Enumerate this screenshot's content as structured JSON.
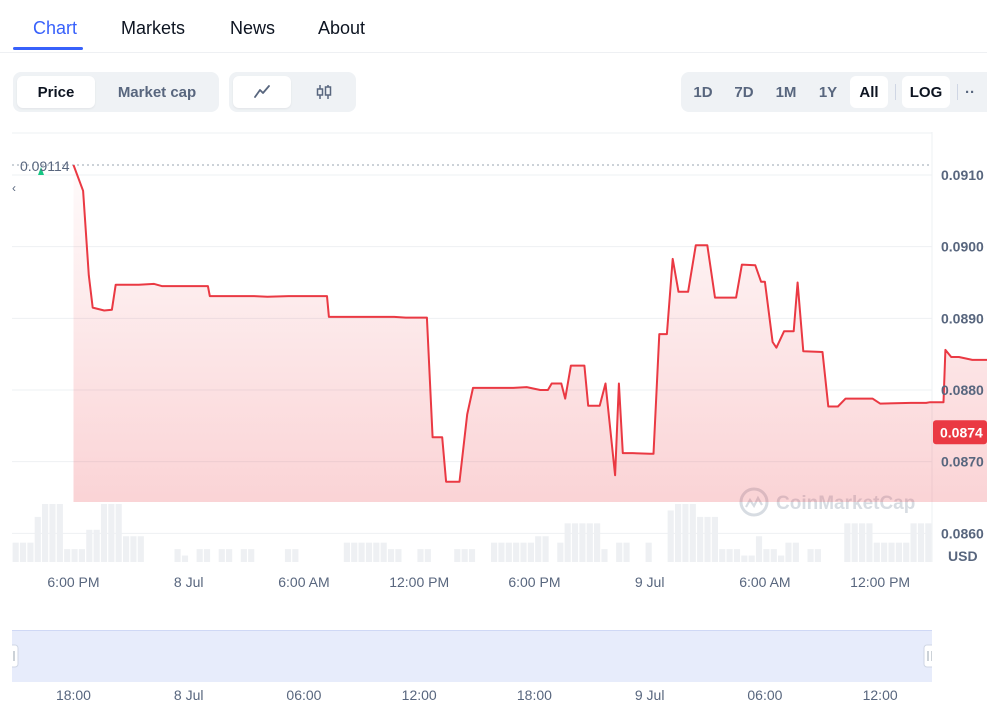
{
  "tabs": [
    {
      "label": "Chart",
      "active": true
    },
    {
      "label": "Markets",
      "active": false
    },
    {
      "label": "News",
      "active": false
    },
    {
      "label": "About",
      "active": false
    }
  ],
  "toolbar": {
    "metric_toggle": [
      {
        "label": "Price",
        "active": true
      },
      {
        "label": "Market cap",
        "active": false
      }
    ],
    "chart_type_toggle": [
      {
        "icon": "line-chart-icon",
        "active": true
      },
      {
        "icon": "candlestick-icon",
        "active": false
      }
    ],
    "ranges": [
      {
        "label": "1D",
        "active": false
      },
      {
        "label": "7D",
        "active": false
      },
      {
        "label": "1M",
        "active": false
      },
      {
        "label": "1Y",
        "active": false
      },
      {
        "label": "All",
        "active": true
      }
    ],
    "log_label": "LOG",
    "more_label": "··"
  },
  "colors": {
    "accent": "#3861fb",
    "line": "#ea3943",
    "up_marker": "#16c784",
    "text_muted": "#58667e"
  },
  "watermark": "CoinMarketCap",
  "open_price_label": "0.09114",
  "current_price_label": "0.0874",
  "currency_label": "USD",
  "chart_data": {
    "type": "line",
    "x_tick_labels": [
      "6:00 PM",
      "8 Jul",
      "6:00 AM",
      "12:00 PM",
      "6:00 PM",
      "9 Jul",
      "6:00 AM",
      "12:00 PM"
    ],
    "y_tick_labels": [
      "0.0910",
      "0.0900",
      "0.0890",
      "0.0880",
      "0.0870",
      "0.0860"
    ],
    "ylim": [
      0.0856,
      0.0916
    ],
    "xlim": [
      -3.2,
      44.7
    ],
    "x_unit": "hours after 6:00 PM, 7 Jul",
    "grid": true,
    "series": [
      {
        "name": "",
        "values": [
          [
            0,
            0.09114
          ],
          [
            0.5,
            0.09078
          ],
          [
            0.8,
            0.0896
          ],
          [
            1.0,
            0.08915
          ],
          [
            1.6,
            0.08911
          ],
          [
            2.0,
            0.08912
          ],
          [
            2.2,
            0.08947
          ],
          [
            3.4,
            0.08947
          ],
          [
            4.2,
            0.08948
          ],
          [
            4.6,
            0.08945
          ],
          [
            7.0,
            0.08945
          ],
          [
            7.1,
            0.08931
          ],
          [
            9.4,
            0.08931
          ],
          [
            10.1,
            0.0893
          ],
          [
            11.2,
            0.08931
          ],
          [
            12.7,
            0.08931
          ],
          [
            13.2,
            0.08931
          ],
          [
            13.3,
            0.08902
          ],
          [
            16.7,
            0.08902
          ],
          [
            17.3,
            0.08901
          ],
          [
            18.4,
            0.08901
          ],
          [
            18.7,
            0.08734
          ],
          [
            19.2,
            0.08734
          ],
          [
            19.4,
            0.08672
          ],
          [
            20.1,
            0.08672
          ],
          [
            20.5,
            0.08766
          ],
          [
            20.8,
            0.08803
          ],
          [
            22.9,
            0.08803
          ],
          [
            23.6,
            0.08804
          ],
          [
            24.3,
            0.088
          ],
          [
            24.7,
            0.088
          ],
          [
            24.9,
            0.08809
          ],
          [
            25.4,
            0.08809
          ],
          [
            25.6,
            0.08788
          ],
          [
            25.9,
            0.08834
          ],
          [
            26.6,
            0.08834
          ],
          [
            26.8,
            0.08778
          ],
          [
            27.4,
            0.08778
          ],
          [
            27.7,
            0.08809
          ],
          [
            28.2,
            0.08681
          ],
          [
            28.4,
            0.08809
          ],
          [
            28.6,
            0.08712
          ],
          [
            29.1,
            0.08712
          ],
          [
            30.0,
            0.08711
          ],
          [
            30.2,
            0.08711
          ],
          [
            30.5,
            0.08878
          ],
          [
            30.9,
            0.08878
          ],
          [
            31.2,
            0.08983
          ],
          [
            31.5,
            0.08937
          ],
          [
            32.0,
            0.08937
          ],
          [
            32.4,
            0.09002
          ],
          [
            33.0,
            0.09002
          ],
          [
            33.4,
            0.08929
          ],
          [
            34.5,
            0.08929
          ],
          [
            34.8,
            0.08975
          ],
          [
            35.5,
            0.08974
          ],
          [
            35.8,
            0.08951
          ],
          [
            36.0,
            0.08951
          ],
          [
            36.4,
            0.08867
          ],
          [
            36.6,
            0.08859
          ],
          [
            37.0,
            0.08882
          ],
          [
            37.5,
            0.08882
          ],
          [
            37.7,
            0.0895
          ],
          [
            38.0,
            0.08854
          ],
          [
            39.0,
            0.08853
          ],
          [
            39.3,
            0.08777
          ],
          [
            39.8,
            0.08777
          ],
          [
            40.2,
            0.08788
          ],
          [
            41.6,
            0.08788
          ],
          [
            42.0,
            0.08781
          ],
          [
            43.6,
            0.08782
          ],
          [
            44.4,
            0.08782
          ],
          [
            44.6,
            0.08783
          ],
          [
            45.0,
            0.08783
          ],
          [
            45.3,
            0.08783
          ],
          [
            45.4,
            0.08856
          ],
          [
            45.7,
            0.08846
          ],
          [
            46.1,
            0.08846
          ],
          [
            46.8,
            0.08842
          ],
          [
            47.9,
            0.08842
          ],
          [
            48.2,
            0.0879
          ],
          [
            48.5,
            0.08787
          ],
          [
            48.8,
            0.08737
          ],
          [
            49.0,
            0.08741
          ],
          [
            50.5,
            0.08741
          ]
        ]
      }
    ],
    "volume_bars": [
      3,
      3,
      3,
      7,
      9,
      9,
      9,
      2,
      2,
      2,
      5,
      5,
      9,
      9,
      9,
      4,
      4,
      4,
      0,
      0,
      0,
      0,
      2,
      1,
      0,
      2,
      2,
      0,
      2,
      2,
      0,
      2,
      2,
      0,
      0,
      0,
      0,
      2,
      2,
      0,
      0,
      0,
      0,
      0,
      0,
      3,
      3,
      3,
      3,
      3,
      3,
      2,
      2,
      0,
      0,
      2,
      2,
      0,
      0,
      0,
      2,
      2,
      2,
      0,
      0,
      3,
      3,
      3,
      3,
      3,
      3,
      4,
      4,
      0,
      3,
      6,
      6,
      6,
      6,
      6,
      2,
      0,
      3,
      3,
      0,
      0,
      3,
      0,
      0,
      8,
      9,
      9,
      9,
      7,
      7,
      7,
      2,
      2,
      2,
      1,
      1,
      4,
      2,
      2,
      1,
      3,
      3,
      0,
      2,
      2,
      0,
      0,
      0,
      6,
      6,
      6,
      6,
      3,
      3,
      3,
      3,
      3,
      6,
      6,
      6
    ],
    "navigator_tick_labels": [
      "18:00",
      "8 Jul",
      "06:00",
      "12:00",
      "18:00",
      "9 Jul",
      "06:00",
      "12:00"
    ]
  }
}
